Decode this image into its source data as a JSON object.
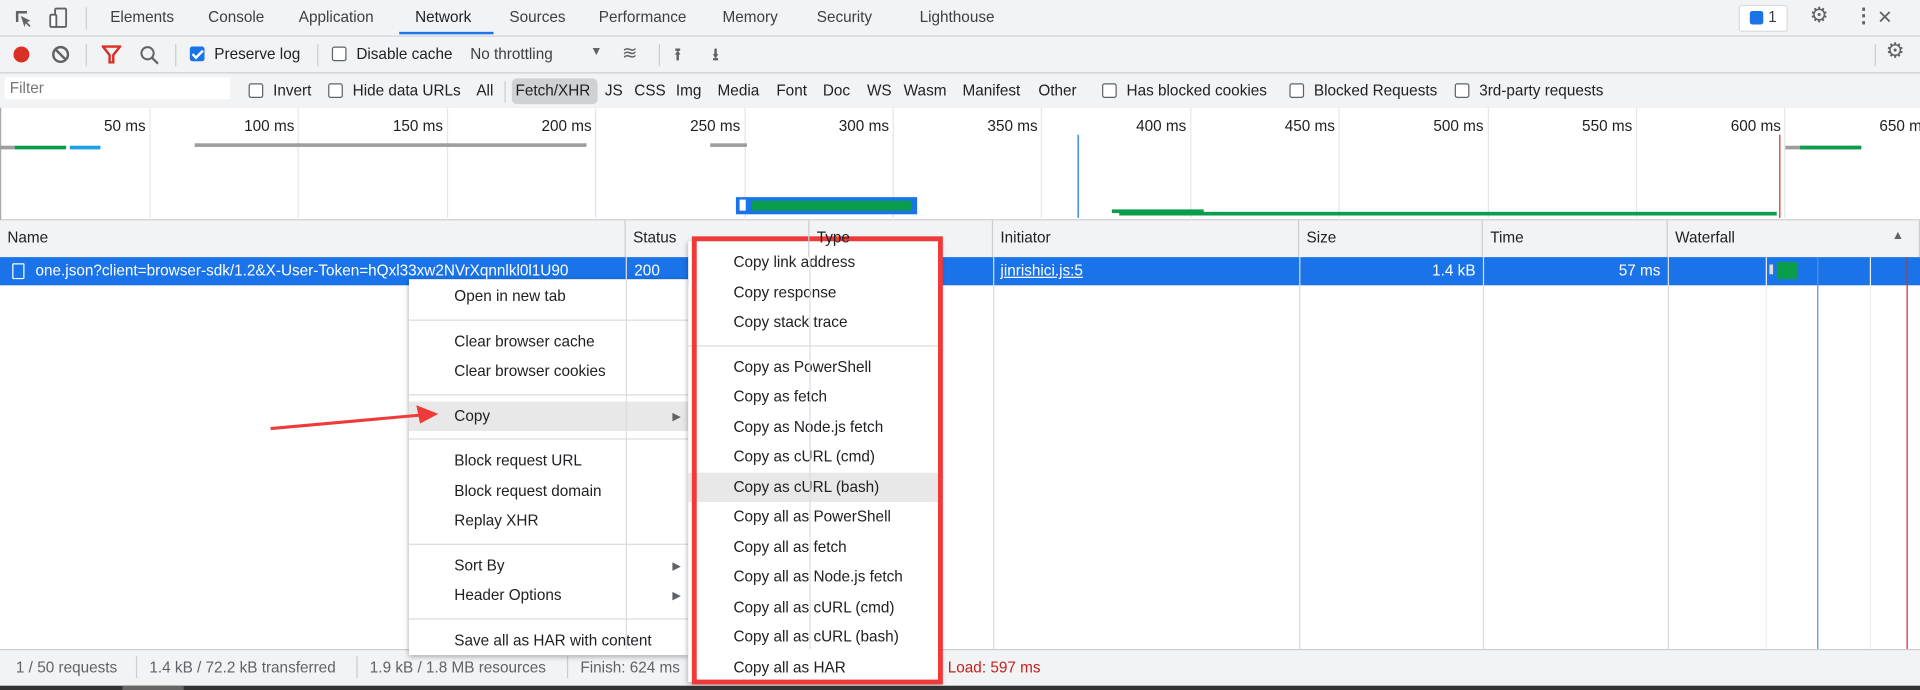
{
  "tabs": {
    "items": [
      "Elements",
      "Console",
      "Application",
      "Network",
      "Sources",
      "Performance",
      "Memory",
      "Security",
      "Lighthouse"
    ],
    "active": "Network",
    "issues_badge": "1"
  },
  "toolbar": {
    "preserve_log": "Preserve log",
    "preserve_log_checked": true,
    "disable_cache": "Disable cache",
    "disable_cache_checked": false,
    "throttling": "No throttling"
  },
  "filter": {
    "placeholder": "Filter",
    "value": "",
    "invert": "Invert",
    "hide_data_urls": "Hide data URLs",
    "types": [
      "All",
      "Fetch/XHR",
      "JS",
      "CSS",
      "Img",
      "Media",
      "Font",
      "Doc",
      "WS",
      "Wasm",
      "Manifest",
      "Other"
    ],
    "active_type": "Fetch/XHR",
    "has_blocked_cookies": "Has blocked cookies",
    "blocked_requests": "Blocked Requests",
    "third_party": "3rd-party requests"
  },
  "overview": {
    "ticks": [
      "50 ms",
      "100 ms",
      "150 ms",
      "200 ms",
      "250 ms",
      "300 ms",
      "350 ms",
      "400 ms",
      "450 ms",
      "500 ms",
      "550 ms",
      "600 ms",
      "650 ms"
    ]
  },
  "table": {
    "columns": [
      "Name",
      "Status",
      "Type",
      "Initiator",
      "Size",
      "Time",
      "Waterfall"
    ],
    "rows": [
      {
        "name": "one.json?client=browser-sdk/1.2&X-User-Token=hQxl33xw2NVrXqnnlkl0l1U90",
        "status": "200",
        "type": "",
        "initiator": "jinrishici.js:5",
        "size": "1.4 kB",
        "time": "57 ms",
        "selected": true
      }
    ]
  },
  "context_menu": {
    "groups": [
      [
        "Open in new tab"
      ],
      [
        "Clear browser cache",
        "Clear browser cookies"
      ],
      [
        "Copy"
      ],
      [
        "Block request URL",
        "Block request domain",
        "Replay XHR"
      ],
      [
        "Sort By",
        "Header Options"
      ],
      [
        "Save all as HAR with content"
      ]
    ],
    "highlighted": "Copy",
    "submenu_items": [
      "Copy",
      "Sort By",
      "Header Options"
    ]
  },
  "copy_submenu": {
    "groups": [
      [
        "Copy link address",
        "Copy response",
        "Copy stack trace"
      ],
      [
        "Copy as PowerShell",
        "Copy as fetch",
        "Copy as Node.js fetch",
        "Copy as cURL (cmd)",
        "Copy as cURL (bash)",
        "Copy all as PowerShell",
        "Copy all as fetch",
        "Copy all as Node.js fetch",
        "Copy all as cURL (cmd)",
        "Copy all as cURL (bash)",
        "Copy all as HAR"
      ]
    ],
    "highlighted": "Copy as cURL (bash)"
  },
  "status_bar": {
    "requests": "1 / 50 requests",
    "transferred": "1.4 kB / 72.2 kB transferred",
    "resources": "1.9 kB / 1.8 MB resources",
    "finish": "Finish: 624 ms",
    "load": "Load: 597 ms"
  },
  "colors": {
    "accent": "#1a73e8",
    "highlight_box": "#f03a3a",
    "load": "#c5221f",
    "dom_content_loaded": "#1a73e8"
  }
}
